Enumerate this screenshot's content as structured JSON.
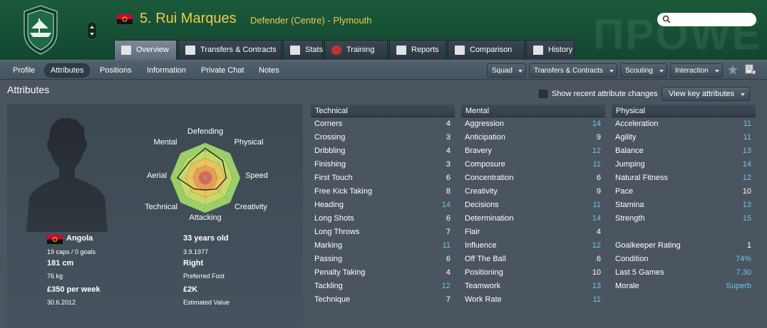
{
  "header": {
    "player_name": "5. Rui Marques",
    "position_club": "Defender (Centre) - Plymouth",
    "watermark": "ΠPOWE",
    "search_placeholder": "",
    "colors": {
      "accent": "#f2c94c",
      "header_bg": "#1b5a3a",
      "highlight": "#6ec3ef"
    },
    "crest_icon": "club-crest-icon",
    "flag_icon": "angola-flag-icon"
  },
  "tabs": [
    {
      "label": "Overview",
      "icon": "overview-icon",
      "active": true
    },
    {
      "label": "Transfers & Contracts",
      "icon": "contract-icon"
    },
    {
      "label": "Stats",
      "icon": "stats-icon"
    },
    {
      "label": "Training",
      "icon": "training-icon"
    },
    {
      "label": "Reports",
      "icon": "reports-icon"
    },
    {
      "label": "Comparison",
      "icon": "comparison-icon"
    },
    {
      "label": "History",
      "icon": "history-icon"
    }
  ],
  "subnav": {
    "items": [
      "Profile",
      "Attributes",
      "Positions",
      "Information",
      "Private Chat",
      "Notes"
    ],
    "active": "Attributes",
    "dropdowns": [
      "Squad",
      "Transfers & Contracts",
      "Scouting",
      "Interaction"
    ]
  },
  "section_title": "Attributes",
  "show_recent_label": "Show recent attribute changes",
  "key_attributes_button": "View key attributes",
  "radar_labels": {
    "defending": "Defending",
    "physical": "Physical",
    "speed": "Speed",
    "creativity": "Creativity",
    "attacking": "Attacking",
    "technical": "Technical",
    "aerial": "Aerial",
    "mental": "Mental"
  },
  "radar_values": {
    "defending": 0.85,
    "physical": 0.7,
    "speed": 0.6,
    "creativity": 0.45,
    "attacking": 0.35,
    "technical": 0.45,
    "aerial": 0.8,
    "mental": 0.65
  },
  "player_info": {
    "nationality": "Angola",
    "caps": "19 caps / 0 goals",
    "height": "181 cm",
    "weight": "76 kg",
    "wage": "£350 per week",
    "contract_end": "30.6.2012",
    "age": "33 years old",
    "dob": "3.9.1977",
    "foot": "Right",
    "foot_label": "Preferred Foot",
    "value": "£2K",
    "value_label": "Estimated Value"
  },
  "technical": {
    "title": "Technical",
    "rows": [
      {
        "name": "Corners",
        "value": "4"
      },
      {
        "name": "Crossing",
        "value": "3"
      },
      {
        "name": "Dribbling",
        "value": "4"
      },
      {
        "name": "Finishing",
        "value": "3"
      },
      {
        "name": "First Touch",
        "value": "6"
      },
      {
        "name": "Free Kick Taking",
        "value": "8"
      },
      {
        "name": "Heading",
        "value": "14",
        "hi": true
      },
      {
        "name": "Long Shots",
        "value": "6"
      },
      {
        "name": "Long Throws",
        "value": "7"
      },
      {
        "name": "Marking",
        "value": "11",
        "hi": true
      },
      {
        "name": "Passing",
        "value": "6"
      },
      {
        "name": "Penalty Taking",
        "value": "4"
      },
      {
        "name": "Tackling",
        "value": "12",
        "hi": true
      },
      {
        "name": "Technique",
        "value": "7"
      }
    ]
  },
  "mental": {
    "title": "Mental",
    "rows": [
      {
        "name": "Aggression",
        "value": "14",
        "hi": true
      },
      {
        "name": "Anticipation",
        "value": "9"
      },
      {
        "name": "Bravery",
        "value": "12",
        "hi": true
      },
      {
        "name": "Composure",
        "value": "11",
        "hi": true
      },
      {
        "name": "Concentration",
        "value": "6"
      },
      {
        "name": "Creativity",
        "value": "9"
      },
      {
        "name": "Decisions",
        "value": "11",
        "hi": true
      },
      {
        "name": "Determination",
        "value": "14",
        "hi": true
      },
      {
        "name": "Flair",
        "value": "4"
      },
      {
        "name": "Influence",
        "value": "12",
        "hi": true
      },
      {
        "name": "Off The Ball",
        "value": "6"
      },
      {
        "name": "Positioning",
        "value": "10"
      },
      {
        "name": "Teamwork",
        "value": "13",
        "hi": true
      },
      {
        "name": "Work Rate",
        "value": "11",
        "hi": true
      }
    ]
  },
  "physical": {
    "title": "Physical",
    "rows": [
      {
        "name": "Acceleration",
        "value": "11",
        "hi": true
      },
      {
        "name": "Agility",
        "value": "11",
        "hi": true
      },
      {
        "name": "Balance",
        "value": "13",
        "hi": true
      },
      {
        "name": "Jumping",
        "value": "14",
        "hi": true
      },
      {
        "name": "Natural Fitness",
        "value": "12",
        "hi": true
      },
      {
        "name": "Pace",
        "value": "10"
      },
      {
        "name": "Stamina",
        "value": "13",
        "hi": true
      },
      {
        "name": "Strength",
        "value": "15",
        "hi": true
      }
    ],
    "extra": [
      {
        "name": "Goalkeeper Rating",
        "value": "1"
      },
      {
        "name": "Condition",
        "value": "74%",
        "hi": true
      },
      {
        "name": "Last 5 Games",
        "value": "7.30",
        "hi": true
      },
      {
        "name": "Morale",
        "value": "Superb",
        "hi": true
      }
    ]
  }
}
